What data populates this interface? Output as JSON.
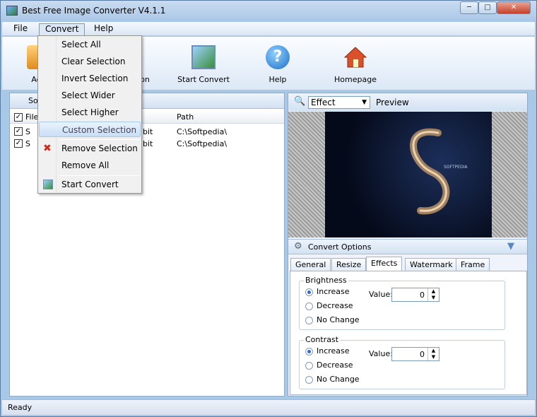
{
  "window": {
    "title": "Best Free Image Converter V4.1.1"
  },
  "menubar": {
    "items": [
      "File",
      "Convert",
      "Help"
    ]
  },
  "toolbar": {
    "add_label": "Add",
    "dest_label": "ation",
    "start_label": "Start Convert",
    "help_label": "Help",
    "home_label": "Homepage"
  },
  "left_panel": {
    "header": "So",
    "columns": [
      "File",
      "Path"
    ],
    "rows": [
      {
        "checked": true,
        "name": "S",
        "bit": "bit",
        "path": "C:\\Softpedia\\"
      },
      {
        "checked": true,
        "name": "S",
        "bit": "bit",
        "path": "C:\\Softpedia\\"
      }
    ]
  },
  "preview": {
    "effect_value": "Effect",
    "label": "Preview",
    "image_text": "SOFTPEDIA"
  },
  "convert_options": {
    "label": "Convert Options",
    "tabs": [
      "General",
      "Resize",
      "Effects",
      "Watermark",
      "Frame"
    ],
    "active_tab": "Effects",
    "brightness": {
      "title": "Brightness",
      "options": [
        "Increase",
        "Decrease",
        "No Change"
      ],
      "selected": "Increase",
      "value_label": "Value:",
      "value": "0"
    },
    "contrast": {
      "title": "Contrast",
      "options": [
        "Increase",
        "Decrease",
        "No Change"
      ],
      "selected": "Increase",
      "value_label": "Value:",
      "value": "0"
    }
  },
  "convert_menu": {
    "items": [
      "Select All",
      "Clear Selection",
      "Invert Selection",
      "Select Wider",
      "Select Higher",
      "Custom Selection",
      "Remove Selection",
      "Remove All",
      "Start Convert"
    ],
    "highlighted": "Custom Selection"
  },
  "status": {
    "text": "Ready"
  },
  "colors": {
    "accent": "#2a6bd8",
    "frame": "#a8c8e8"
  }
}
